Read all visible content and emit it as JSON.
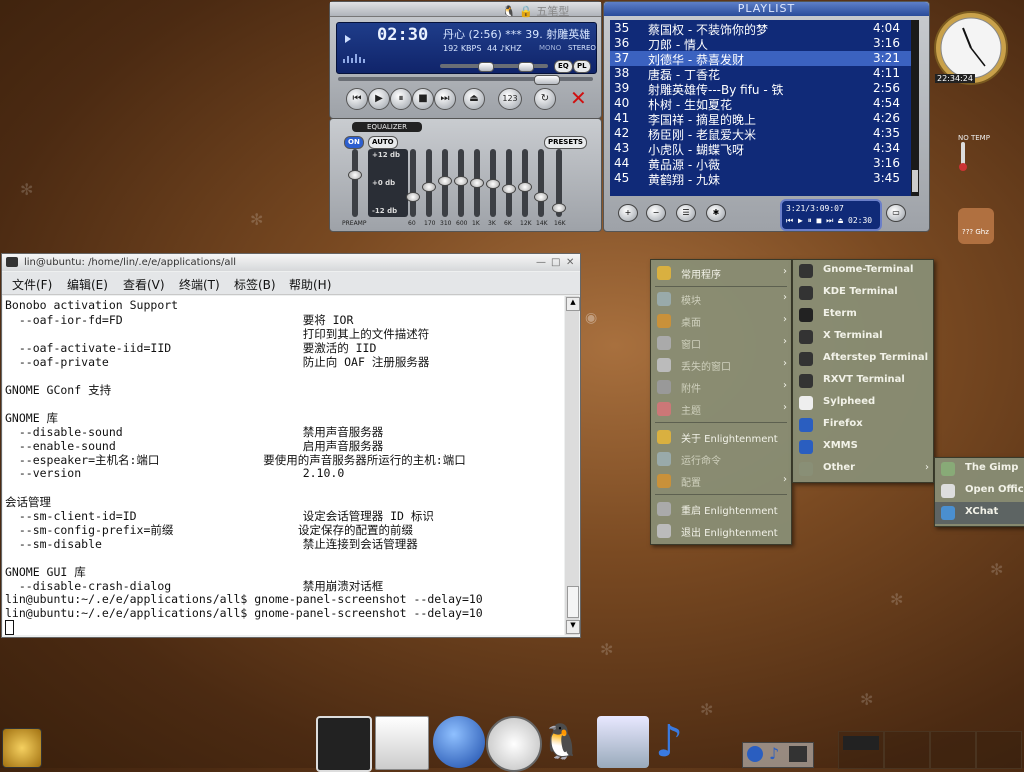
{
  "xmms": {
    "time": "02:30",
    "song": "丹心 (2:56) *** 39. 射雕英雄",
    "kbps": "192 KBPS",
    "khz": "44 ♪KHZ",
    "mode_label": "MONO",
    "stereo_label": "STEREO",
    "qq_text": "五笔型",
    "eq_button": "EQ",
    "pl_button": "PL"
  },
  "equalizer": {
    "title": "EQUALIZER",
    "on_label": "ON",
    "auto_label": "AUTO",
    "presets_label": "PRESETS",
    "db_top": "+12 db",
    "db_mid": "+0 db",
    "db_bottom": "-12 db",
    "preamp_label": "PREAMP",
    "bands": [
      "60",
      "170",
      "310",
      "600",
      "1K",
      "3K",
      "6K",
      "12K",
      "14K",
      "16K"
    ],
    "band_levels": [
      0.35,
      0.72,
      0.55,
      0.45,
      0.45,
      0.48,
      0.5,
      0.58,
      0.55,
      0.72,
      0.9
    ]
  },
  "playlist": {
    "title": "PLAYLIST",
    "items": [
      {
        "num": "35",
        "title": "蔡国权 - 不装饰你的梦",
        "dur": "4:04"
      },
      {
        "num": "36",
        "title": "刀郎 - 情人",
        "dur": "3:16"
      },
      {
        "num": "37",
        "title": "刘德华 - 恭喜发财",
        "dur": "3:21"
      },
      {
        "num": "38",
        "title": "唐磊 - 丁香花",
        "dur": "4:11"
      },
      {
        "num": "39",
        "title": "射雕英雄传---By fifu - 铁",
        "dur": "2:56"
      },
      {
        "num": "40",
        "title": "朴树 - 生如夏花",
        "dur": "4:54"
      },
      {
        "num": "41",
        "title": "李国祥 - 摘星的晚上",
        "dur": "4:26"
      },
      {
        "num": "42",
        "title": "杨臣刚 - 老鼠爱大米",
        "dur": "4:35"
      },
      {
        "num": "43",
        "title": "小虎队 - 蝴蝶飞呀",
        "dur": "4:34"
      },
      {
        "num": "44",
        "title": "黄品源 - 小薇",
        "dur": "3:16"
      },
      {
        "num": "45",
        "title": "黄鹤翔 - 九妹",
        "dur": "3:45"
      }
    ],
    "selected_index": 2,
    "mini_info": "3:21/3:09:07",
    "mini_time": "02:30"
  },
  "clock": {
    "time_text": "22:34:24"
  },
  "temp": {
    "label": "NO TEMP"
  },
  "cpu": {
    "label": "??? Ghz"
  },
  "terminal": {
    "title": "lin@ubuntu: /home/lin/.e/e/applications/all",
    "menu": [
      "文件(F)",
      "编辑(E)",
      "查看(V)",
      "终端(T)",
      "标签(B)",
      "帮助(H)"
    ],
    "lines": [
      "Bonobo activation Support",
      "  --oaf-ior-fd=FD                          要将 IOR",
      "                                           打印到其上的文件描述符",
      "  --oaf-activate-iid=IID                   要激活的 IID",
      "  --oaf-private                            防止向 OAF 注册服务器",
      "",
      "GNOME GConf 支持",
      "",
      "GNOME 库",
      "  --disable-sound                          禁用声音服务器",
      "  --enable-sound                           启用声音服务器",
      "  --espeaker=主机名:端口               要使用的声音服务器所运行的主机:端口",
      "  --version                                2.10.0",
      "",
      "会话管理",
      "  --sm-client-id=ID                        设定会话管理器 ID 标识",
      "  --sm-config-prefix=前缀                  设定保存的配置的前缀",
      "  --sm-disable                             禁止连接到会话管理器",
      "",
      "GNOME GUI 库",
      "  --disable-crash-dialog                   禁用崩溃对话框",
      "lin@ubuntu:~/.e/e/applications/all$ gnome-panel-screenshot --delay=10",
      "lin@ubuntu:~/.e/e/applications/all$ gnome-panel-screenshot --delay=10",
      ""
    ]
  },
  "main_menu": {
    "items": [
      {
        "label": "常用程序",
        "arrow": true,
        "dim": false
      },
      {
        "label": "模块",
        "arrow": true,
        "dim": true
      },
      {
        "label": "桌面",
        "arrow": true,
        "dim": true
      },
      {
        "label": "窗口",
        "arrow": true,
        "dim": true
      },
      {
        "label": "丢失的窗口",
        "arrow": true,
        "dim": true
      },
      {
        "label": "附件",
        "arrow": true,
        "dim": true
      },
      {
        "label": "主题",
        "arrow": true,
        "dim": true
      },
      {
        "label": "关于 Enlightenment",
        "arrow": false,
        "dim": false
      },
      {
        "label": "运行命令",
        "arrow": false,
        "dim": true
      },
      {
        "label": "配置",
        "arrow": true,
        "dim": true
      },
      {
        "label": "重启 Enlightenment",
        "arrow": false,
        "dim": false
      },
      {
        "label": "退出 Enlightenment",
        "arrow": false,
        "dim": false
      }
    ]
  },
  "apps_menu": {
    "items": [
      {
        "label": "Gnome-Terminal"
      },
      {
        "label": "KDE Terminal"
      },
      {
        "label": "Eterm"
      },
      {
        "label": "X Terminal"
      },
      {
        "label": "Afterstep Terminal"
      },
      {
        "label": "RXVT Terminal"
      },
      {
        "label": "Sylpheed"
      },
      {
        "label": "Firefox"
      },
      {
        "label": "XMMS"
      },
      {
        "label": "Other"
      }
    ]
  },
  "other_menu": {
    "items": [
      {
        "label": "The Gimp"
      },
      {
        "label": "Open Office"
      },
      {
        "label": "XChat"
      }
    ]
  },
  "dock": {
    "items": [
      "terminal-icon",
      "mail-icon",
      "firefox-icon",
      "clock-icon",
      "qq-penguin-icon",
      "gimp-icon",
      "music-note-icon"
    ]
  },
  "colors": {
    "lcd_blue": "#10246a",
    "menu_bg": "#898f76",
    "desktop": "#7a4a22"
  }
}
